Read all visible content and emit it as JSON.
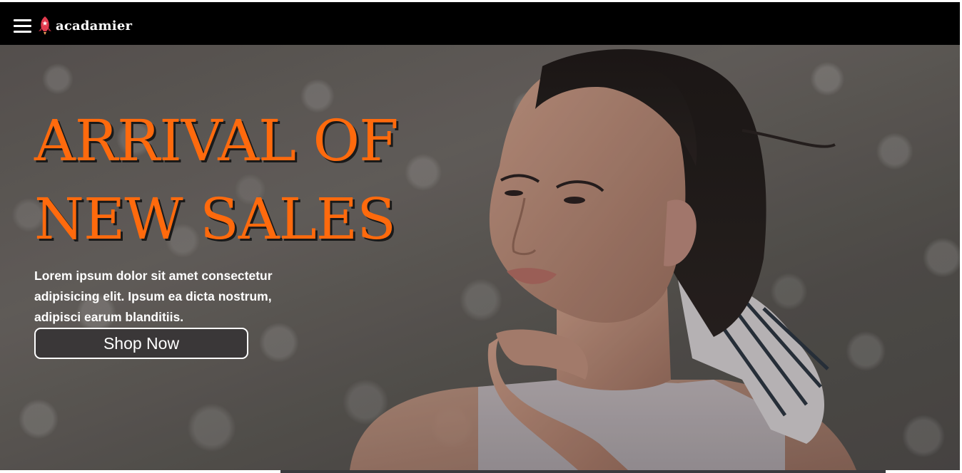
{
  "navbar": {
    "menu_icon": "hamburger-menu-icon",
    "logo_icon": "rocket-logo-icon",
    "logo_text": "acadamier",
    "background": "#000000"
  },
  "hero": {
    "headline_line1": "ARRIVAL OF",
    "headline_line2": "NEW SALES",
    "headline_color": "#ff6a0d",
    "description": "Lorem ipsum dolor sit amet consectetur adipisicing elit. Ipsum ea dicta nostrum, adipisci earum blanditiis.",
    "cta_label": "Shop Now"
  },
  "slider": {
    "progress_fraction": 0.29
  }
}
